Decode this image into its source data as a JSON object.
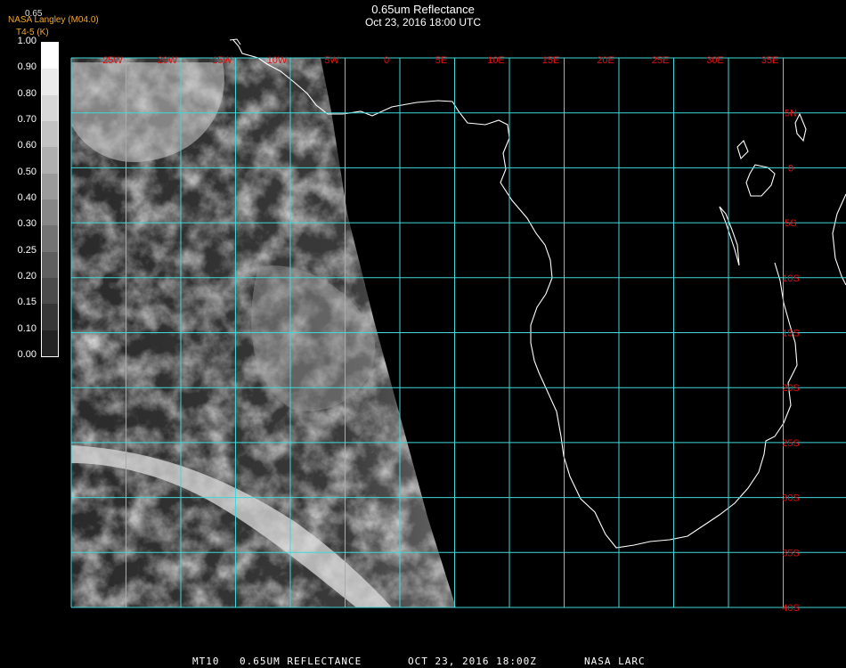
{
  "header": {
    "title": "0.65um Reflectance",
    "datetime": "Oct 23, 2016 18:00 UTC",
    "org": "NASA Langley (M04.0)",
    "sub": "T4-5 (K)",
    "colorbar_title": "0.65"
  },
  "colorbar": {
    "labels": [
      "1.00",
      "0.90",
      "0.80",
      "0.70",
      "0.60",
      "0.50",
      "0.40",
      "0.30",
      "0.25",
      "0.20",
      "0.15",
      "0.10",
      "0.00"
    ]
  },
  "grid": {
    "lon_labels": [
      "25W",
      "20W",
      "15W",
      "10W",
      "5W",
      "0",
      "5E",
      "10E",
      "15E",
      "20E",
      "25E",
      "30E",
      "35E"
    ],
    "lat_labels": [
      "5N",
      "0",
      "5S",
      "10S",
      "15S",
      "20S",
      "25S",
      "30S",
      "35S",
      "40S"
    ],
    "grid_color": "#40d8d8",
    "label_color": "#e01010"
  },
  "footer": {
    "product": "MT10",
    "band": "0.65UM REFLECTANCE",
    "date": "OCT 23, 2016 18:00Z",
    "source": "NASA LARC"
  }
}
